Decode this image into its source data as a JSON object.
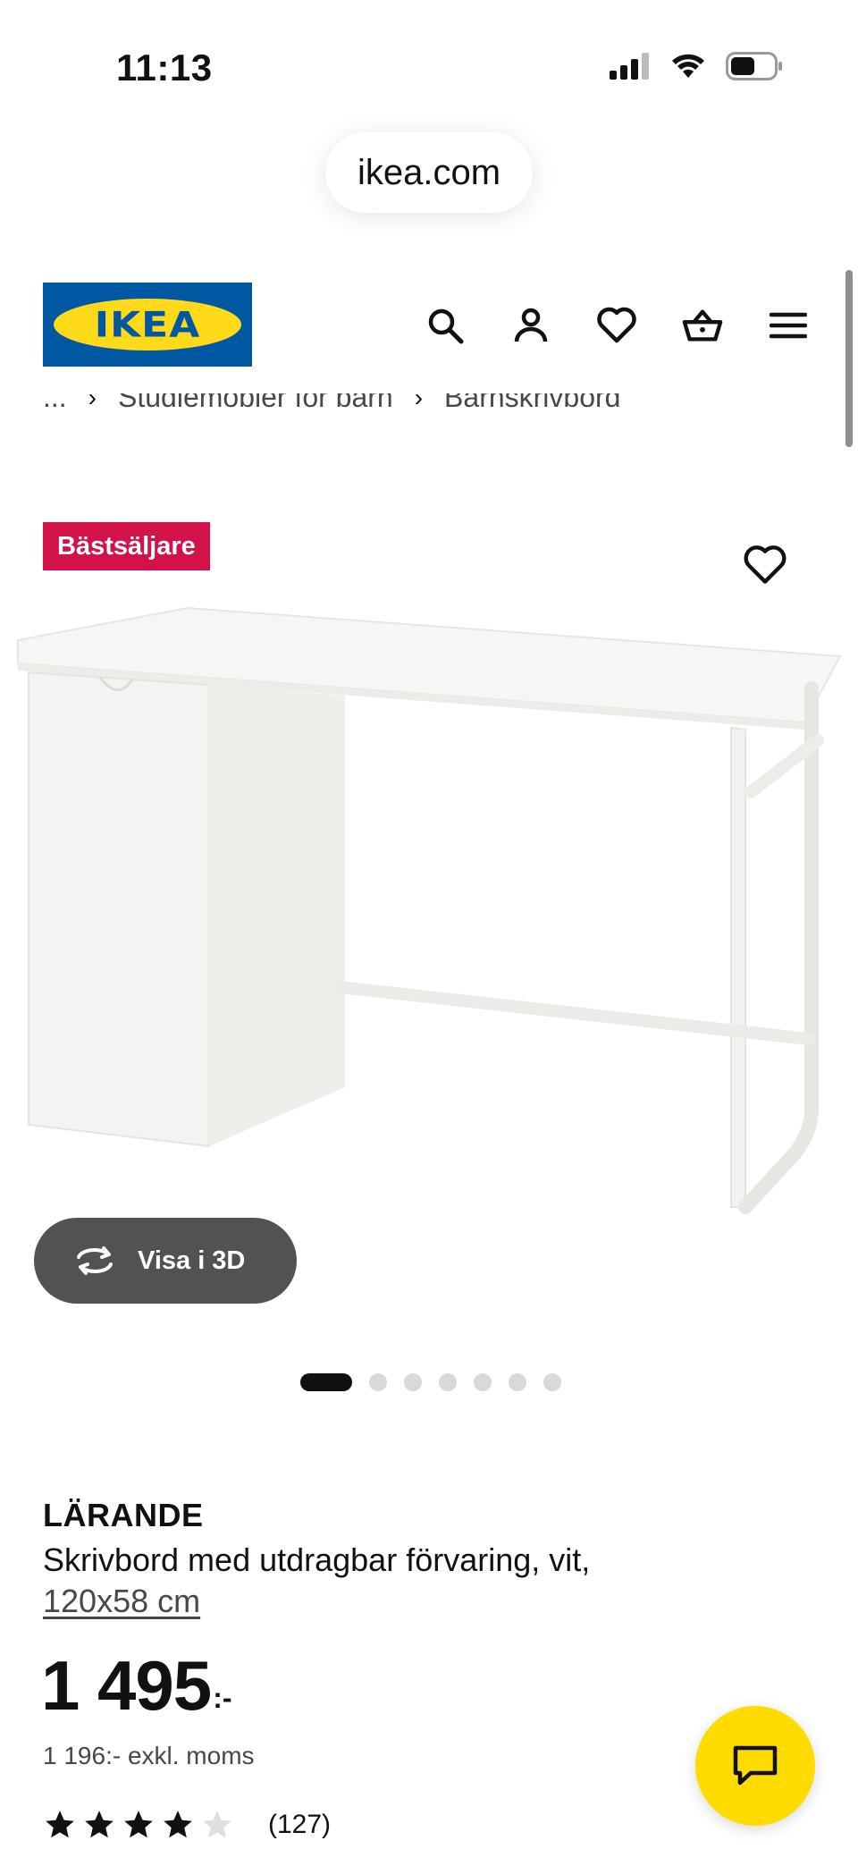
{
  "status_bar": {
    "time": "11:13"
  },
  "browser": {
    "url": "ikea.com"
  },
  "header": {
    "logo_text": "IKEA",
    "icons": [
      "search-icon",
      "account-icon",
      "heart-icon",
      "cart-icon",
      "menu-icon"
    ]
  },
  "breadcrumb": {
    "ellipsis": "...",
    "items": [
      "Studiemöbler för barn",
      "Barnskrivbord"
    ]
  },
  "badge": {
    "label": "Bästsäljare"
  },
  "view_3d": {
    "label": "Visa i 3D"
  },
  "carousel": {
    "count": 7,
    "active_index": 0
  },
  "product": {
    "name": "LÄRANDE",
    "description": "Skrivbord med utdragbar förvaring, vit,",
    "size": "120x58 cm",
    "price": "1 495",
    "price_suffix": ":-",
    "price_excl": "1 196:- exkl. moms",
    "rating": 4,
    "rating_max": 5,
    "review_count": "(127)"
  },
  "colors": {
    "brand_blue": "#0058a3",
    "brand_yellow": "#ffda1a",
    "badge": "#d3124a",
    "chat_fab": "#ffdb00",
    "view_3d_bg": "#525252"
  }
}
